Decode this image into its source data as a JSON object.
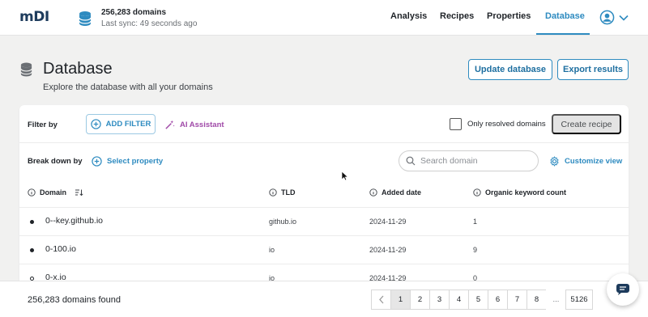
{
  "app": {
    "logo_text": "mDI",
    "db_status": {
      "count": "256,283 domains",
      "sync": "Last sync: 49 seconds ago"
    }
  },
  "nav": {
    "items": [
      "Analysis",
      "Recipes",
      "Properties",
      "Database"
    ],
    "active": "Database"
  },
  "page": {
    "title": "Database",
    "subtitle": "Explore the database with all your domains",
    "update_button": "Update database",
    "export_button": "Export results"
  },
  "filters": {
    "filter_label": "Filter by",
    "add_filter": "ADD FILTER",
    "ai_assistant": "AI Assistant",
    "only_resolved": "Only resolved domains",
    "only_resolved_checked": false,
    "create_recipe": "Create recipe",
    "breakdown_label": "Break down by",
    "select_property": "Select property",
    "search_placeholder": "Search domain",
    "search_value": "",
    "customize_view": "Customize view"
  },
  "table": {
    "headers": [
      "Domain",
      "TLD",
      "Added date",
      "Organic keyword count"
    ],
    "rows": [
      {
        "domain": "0--key.github.io",
        "tld": "github.io",
        "added": "2024-11-29",
        "count": "1"
      },
      {
        "domain": "0-100.io",
        "tld": "io",
        "added": "2024-11-29",
        "count": "9"
      },
      {
        "domain": "0-x.io",
        "tld": "io",
        "added": "2024-11-29",
        "count": "0"
      }
    ]
  },
  "footer": {
    "found": "256,283 domains found",
    "pages": [
      "1",
      "2",
      "3",
      "4",
      "5",
      "6",
      "7",
      "8",
      "...",
      "5126"
    ],
    "current_page": "1"
  },
  "colors": {
    "accent": "#2e8bc0",
    "ai_purple": "#a04aa8",
    "page_bg": "#f1f1f0",
    "logo": "#1d3b5c"
  },
  "icons": {
    "db_indicator": "database-icon",
    "user": "user-circle-icon",
    "title": "database-icon",
    "add_filter": "plus-circle-icon",
    "ai": "magic-wand-icon",
    "select_property": "plus-circle-icon",
    "search": "search-icon",
    "customize": "gear-icon",
    "info": "info-icon",
    "sort": "sort-icon",
    "chat": "chat-icon"
  }
}
